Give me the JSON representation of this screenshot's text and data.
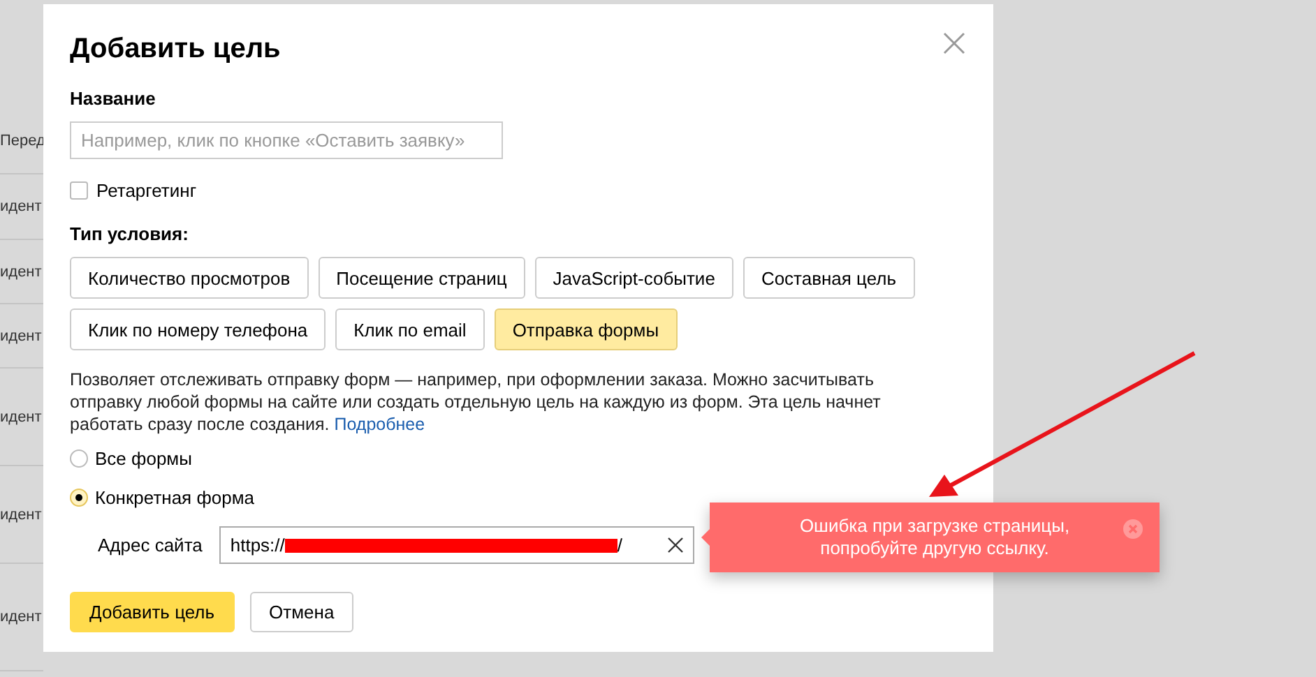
{
  "background_table": {
    "rows": [
      "Перед",
      "идент",
      "идент",
      "идент",
      "идент",
      "идент",
      "идент"
    ]
  },
  "dialog": {
    "title": "Добавить цель",
    "name_label": "Название",
    "name_field": {
      "placeholder": "Например, клик по кнопке «Оставить заявку»"
    },
    "retargeting": {
      "label": "Ретаргетинг",
      "checked": false
    },
    "condition_label": "Тип условия:",
    "condition_types": [
      {
        "label": "Количество просмотров",
        "selected": false
      },
      {
        "label": "Посещение страниц",
        "selected": false
      },
      {
        "label": "JavaScript-событие",
        "selected": false
      },
      {
        "label": "Составная цель",
        "selected": false
      },
      {
        "label": "Клик по номеру телефона",
        "selected": false
      },
      {
        "label": "Клик по email",
        "selected": false
      },
      {
        "label": "Отправка формы",
        "selected": true
      }
    ],
    "description": "Позволяет отслеживать отправку форм — например, при оформлении заказа. Можно засчитывать отправку любой формы на сайте или создать отдельную цель на каждую из форм. Эта цель начнет работать сразу после создания.",
    "more_link": "Подробнее",
    "form_options": [
      {
        "label": "Все формы",
        "selected": false
      },
      {
        "label": "Конкретная форма",
        "selected": true
      }
    ],
    "site_field": {
      "label": "Адрес сайта",
      "value_start": "https://",
      "value_end": "/"
    },
    "buttons": [
      {
        "label": "Добавить цель",
        "kind": "primary"
      },
      {
        "label": "Отмена",
        "kind": "secondary"
      }
    ]
  },
  "toast": {
    "message": "Ошибка при загрузке страницы, попробуйте другую ссылку."
  }
}
